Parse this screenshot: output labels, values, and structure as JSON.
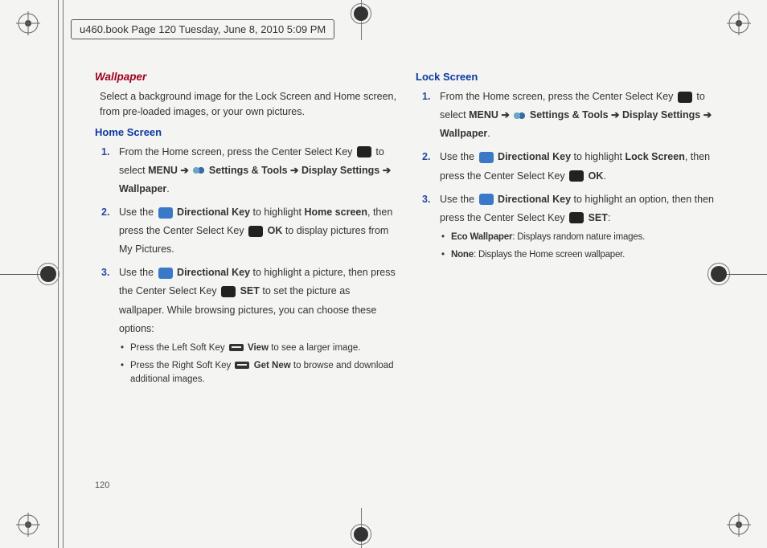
{
  "header": "u460.book  Page 120  Tuesday, June 8, 2010  5:09 PM",
  "page_number": "120",
  "left": {
    "h1": "Wallpaper",
    "intro": "Select a background image for the Lock Screen and Home screen, from pre-loaded images, or your own pictures.",
    "h2": "Home Screen",
    "step1_a": "From the Home screen, press the Center Select Key ",
    "step1_b": " to select ",
    "menu": "MENU",
    "arrow": " ➔ ",
    "st": "Settings & Tools",
    "ds": "Display Settings",
    "wp": "Wallpaper",
    "step2_a": "Use the ",
    "dk": "Directional Key",
    "step2_b": " to highlight ",
    "hs": "Home screen",
    "step2_c": ", then press the Center Select Key ",
    "ok": "OK",
    "step2_d": " to display pictures from My Pictures.",
    "step3_a": "Use the ",
    "step3_b": " to highlight a picture, then press the Center Select Key ",
    "set": "SET",
    "step3_c": " to set the picture as wallpaper.  While browsing pictures, you can choose these options:",
    "bul1_a": "Press the Left Soft Key ",
    "view": "View",
    "bul1_b": " to see a larger image.",
    "bul2_a": "Press the Right Soft Key ",
    "getnew": "Get New",
    "bul2_b": " to browse and download additional images."
  },
  "right": {
    "h2": "Lock Screen",
    "step1_a": "From the Home screen, press the Center Select Key ",
    "step1_b": " to select ",
    "step2_a": "Use the ",
    "step2_b": " to highlight ",
    "ls": "Lock Screen",
    "step2_c": ", then press the Center Select Key ",
    "period": ".",
    "step3_a": "Use the ",
    "step3_b": " to highlight an option, then then press the Center Select Key ",
    "colon": ":",
    "eco": "Eco Wallpaper",
    "eco_d": ": Displays random nature images.",
    "none": "None",
    "none_d": ": Displays the Home screen wallpaper."
  }
}
